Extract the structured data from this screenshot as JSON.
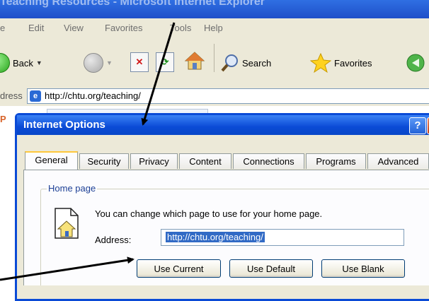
{
  "browser": {
    "title": "Teaching Resources - Microsoft Internet Explorer",
    "menu": [
      "e",
      "Edit",
      "View",
      "Favorites",
      "Tools",
      "Help"
    ],
    "toolbar": {
      "back_label": "Back",
      "search_label": "Search",
      "favorites_label": "Favorites"
    },
    "address_label": "dress",
    "address_value": "http://chtu.org/teaching/",
    "ghost_letter": "P"
  },
  "dialog": {
    "title": "Internet Options",
    "help_glyph": "?",
    "close_glyph": "X",
    "tabs": [
      {
        "label": "General",
        "active": true
      },
      {
        "label": "Security",
        "active": false
      },
      {
        "label": "Privacy",
        "active": false
      },
      {
        "label": "Content",
        "active": false
      },
      {
        "label": "Connections",
        "active": false
      },
      {
        "label": "Programs",
        "active": false
      },
      {
        "label": "Advanced",
        "active": false
      }
    ],
    "home_page": {
      "group_label": "Home page",
      "description": "You can change which page to use for your home page.",
      "address_label": "Address:",
      "address_value": "http://chtu.org/teaching/",
      "buttons": {
        "use_current": "Use Current",
        "use_default": "Use Default",
        "use_blank": "Use Blank"
      }
    }
  },
  "colors": {
    "dialog_title": "#0a4ad6",
    "selection": "#316ac5",
    "dialog_bg": "#ece9d8",
    "group_label": "#1c3f95"
  },
  "icons": {
    "back": "back-arrow-icon",
    "forward": "forward-arrow-icon",
    "stop": "stop-icon",
    "refresh": "refresh-icon",
    "home": "home-icon",
    "search": "search-icon",
    "favorites": "favorites-star-icon",
    "media": "media-icon",
    "ie_page": "ie-page-icon",
    "home_page": "home-page-icon"
  }
}
